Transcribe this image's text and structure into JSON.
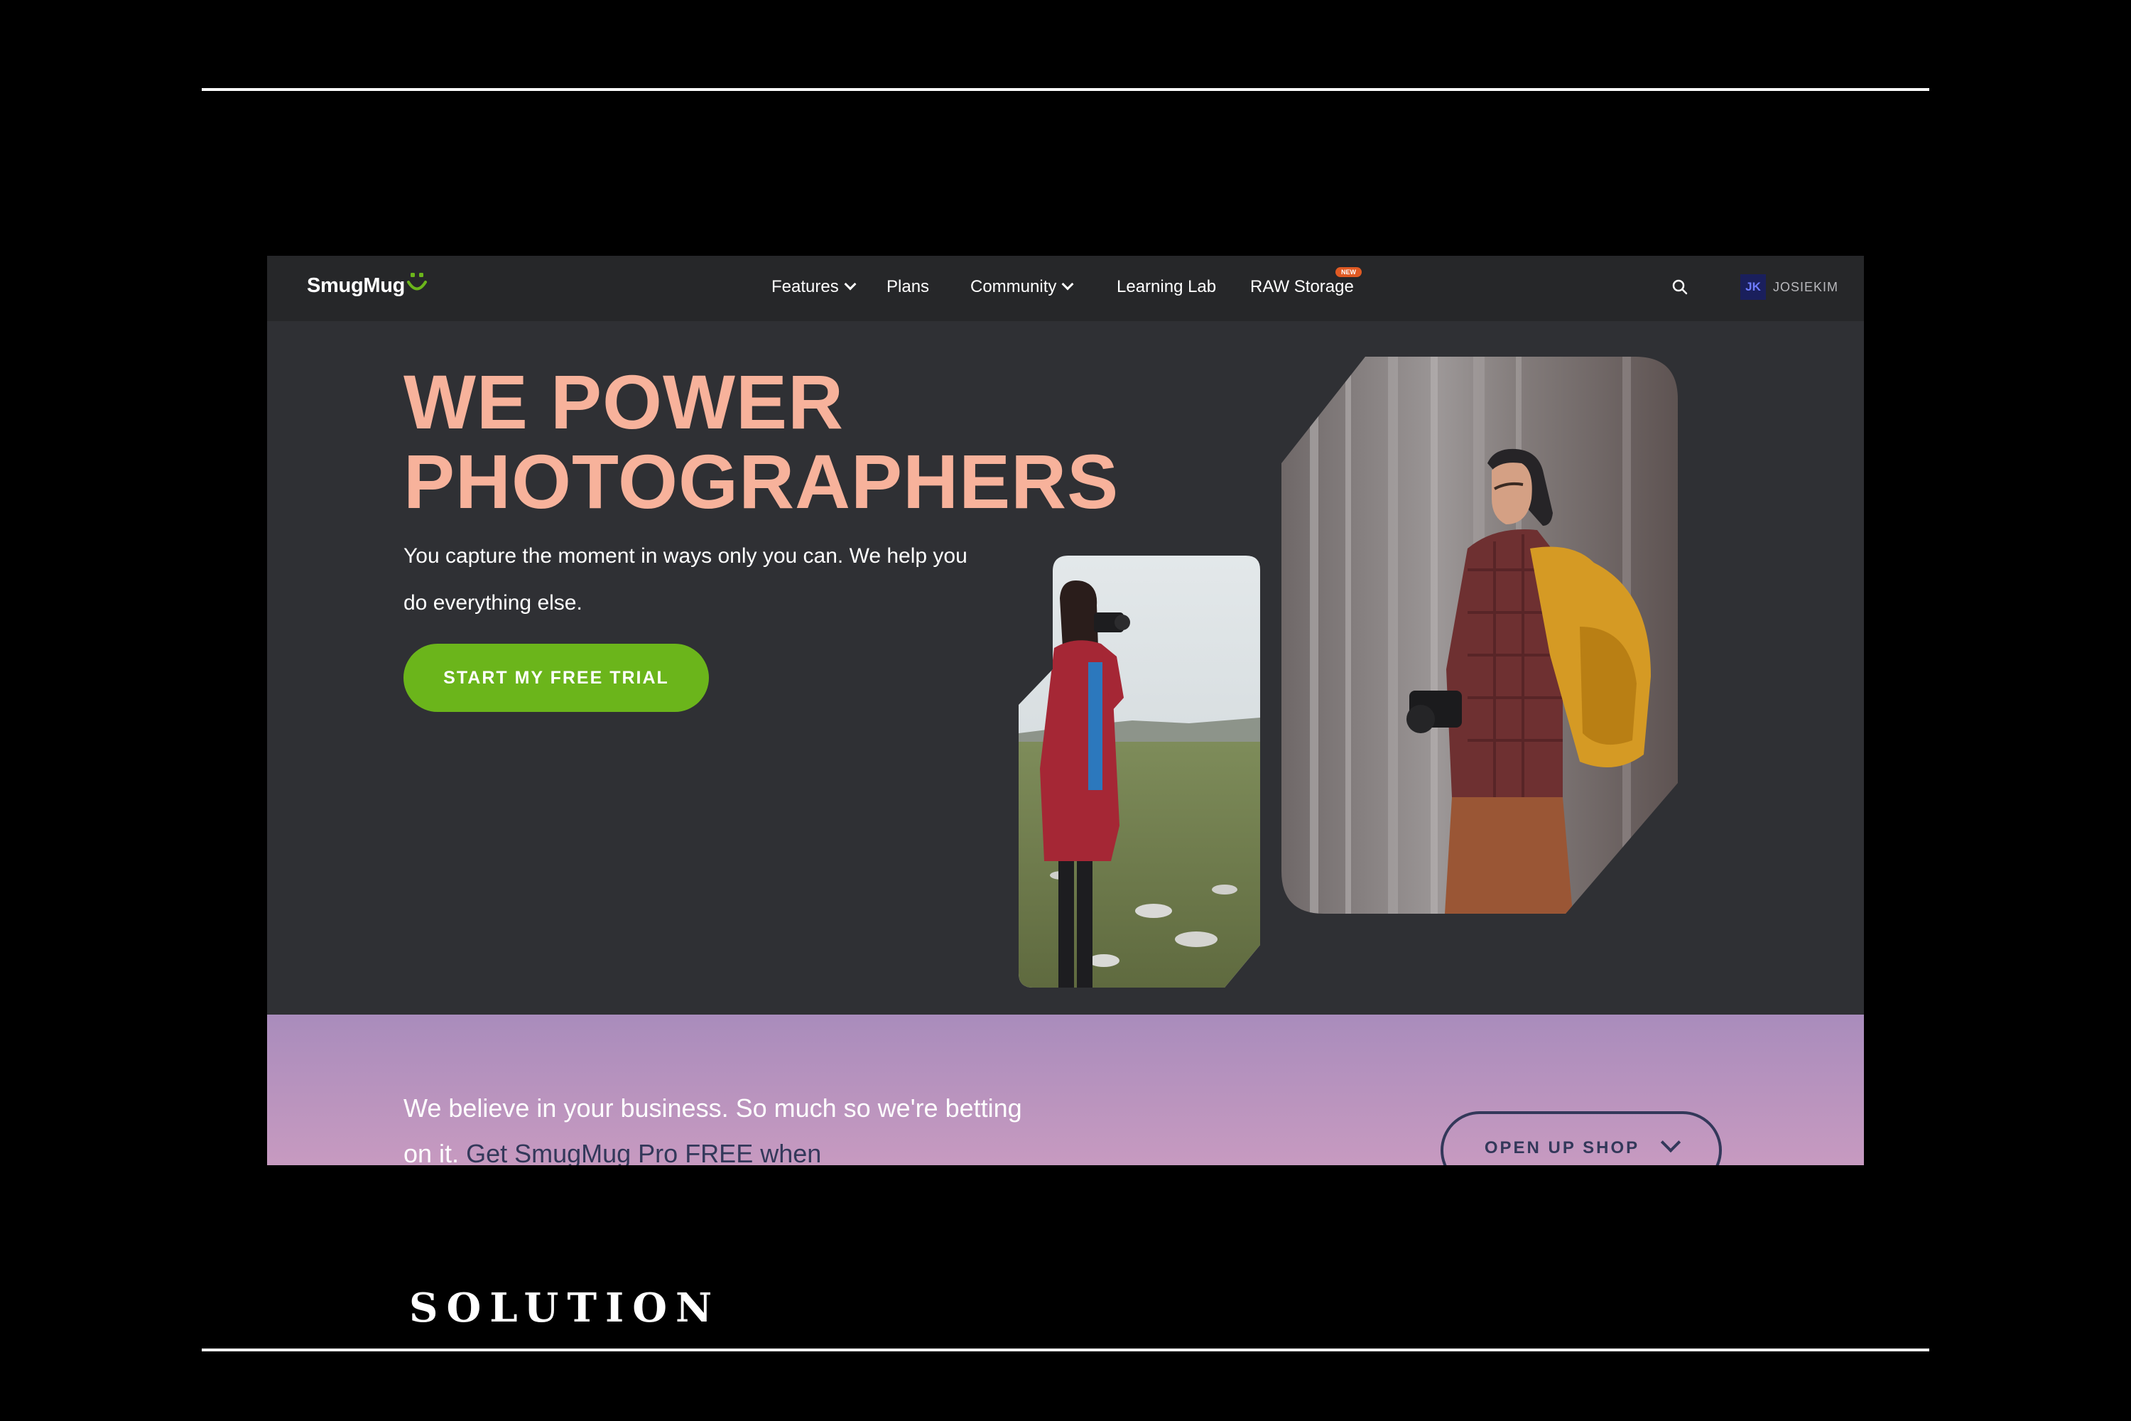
{
  "nav": {
    "logo": "SmugMug",
    "items": {
      "features": "Features",
      "plans": "Plans",
      "community": "Community",
      "learning_lab": "Learning Lab",
      "raw_storage": "RAW Storage"
    },
    "new_badge": "NEW",
    "avatar_initials": "JK",
    "username": "JOSIEKIM"
  },
  "hero": {
    "headline_line1": "WE POWER",
    "headline_line2": "PHOTOGRAPHERS",
    "subtitle": "You capture the moment in ways only you can. We help you do everything else.",
    "cta": "START MY FREE TRIAL"
  },
  "banner": {
    "text": "We believe in your business. So much so we're betting on it.",
    "highlight": "Get SmugMug Pro FREE when",
    "shop_button": "OPEN UP SHOP"
  },
  "footer_label": "SOLUTION",
  "colors": {
    "headline": "#f7b29b",
    "cta": "#6bb51b",
    "background": "#2f3034",
    "banner": "#b393bd",
    "accent_dark": "#33385a"
  }
}
